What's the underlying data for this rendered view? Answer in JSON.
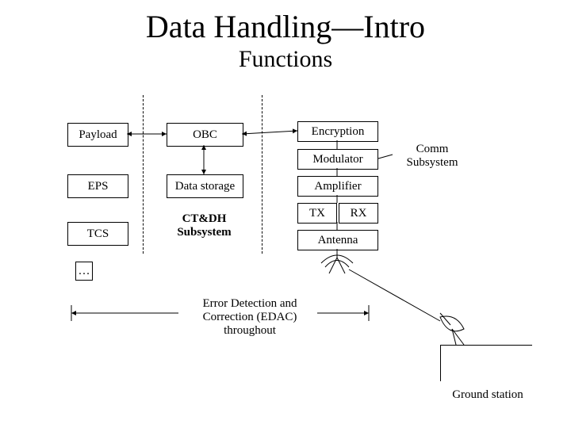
{
  "title": "Data Handling—Intro",
  "subtitle": "Functions",
  "boxes": {
    "payload": "Payload",
    "eps": "EPS",
    "tcs": "TCS",
    "obc": "OBC",
    "datastorage": "Data storage",
    "encryption": "Encryption",
    "modulator": "Modulator",
    "amplifier": "Amplifier",
    "tx": "TX",
    "rx": "RX",
    "antenna": "Antenna",
    "small": "…"
  },
  "labels": {
    "ctdh": "CT&DH\nSubsystem",
    "comm": "Comm\nSubsystem",
    "edac": "Error Detection and\nCorrection (EDAC)\nthroughout",
    "ground": "Ground station"
  }
}
